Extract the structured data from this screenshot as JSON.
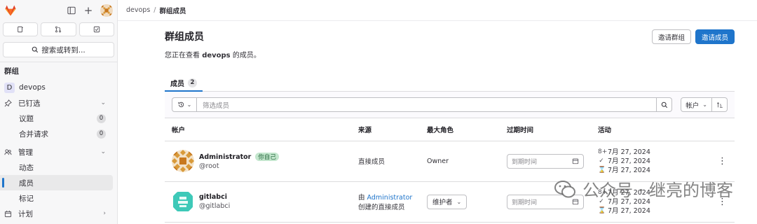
{
  "sidebar": {
    "search_label": "搜索或转到...",
    "section_title": "群组",
    "group_initial": "D",
    "group_name": "devops",
    "items": [
      {
        "label": "已钉选",
        "icon": "pin-icon"
      },
      {
        "label": "议题",
        "badge": "0"
      },
      {
        "label": "合并请求",
        "badge": "0"
      },
      {
        "label": "管理",
        "icon": "users-icon"
      },
      {
        "label": "动态"
      },
      {
        "label": "成员"
      },
      {
        "label": "标记"
      },
      {
        "label": "计划",
        "icon": "calendar-icon"
      }
    ]
  },
  "breadcrumb": {
    "parent": "devops",
    "current": "群组成员"
  },
  "page": {
    "title": "群组成员",
    "subtitle_prefix": "您正在查看",
    "subtitle_group": "devops",
    "subtitle_suffix": "的成员。",
    "invite_group": "邀请群组",
    "invite_members": "邀请成员"
  },
  "tabs": [
    {
      "label": "成员",
      "count": "2"
    }
  ],
  "filter": {
    "placeholder": "筛选成员",
    "sort_label": "帐户"
  },
  "table": {
    "headers": [
      "帐户",
      "来源",
      "最大角色",
      "过期时间",
      "活动"
    ],
    "rows": [
      {
        "name": "Administrator",
        "you_badge": "你自己",
        "handle": "@root",
        "source": "直接成员",
        "role": "Owner",
        "expire_placeholder": "到期时间",
        "activity": [
          "7月 27, 2024",
          "7月 27, 2024",
          "7月 27, 2024"
        ]
      },
      {
        "name": "gitlabci",
        "handle": "@gitlabci",
        "source_prefix": "由",
        "source_link": "Administrator",
        "source_suffix": "创建的直接成员",
        "role": "维护者",
        "expire_placeholder": "到期时间",
        "activity": [
          "7月 27, 2024",
          "7月 27, 2024",
          "7月 27, 2024"
        ]
      }
    ]
  },
  "watermark": "公众号 · 继亮的博客",
  "colors": {
    "primary": "#1f75cb",
    "brand": "#e24329"
  }
}
